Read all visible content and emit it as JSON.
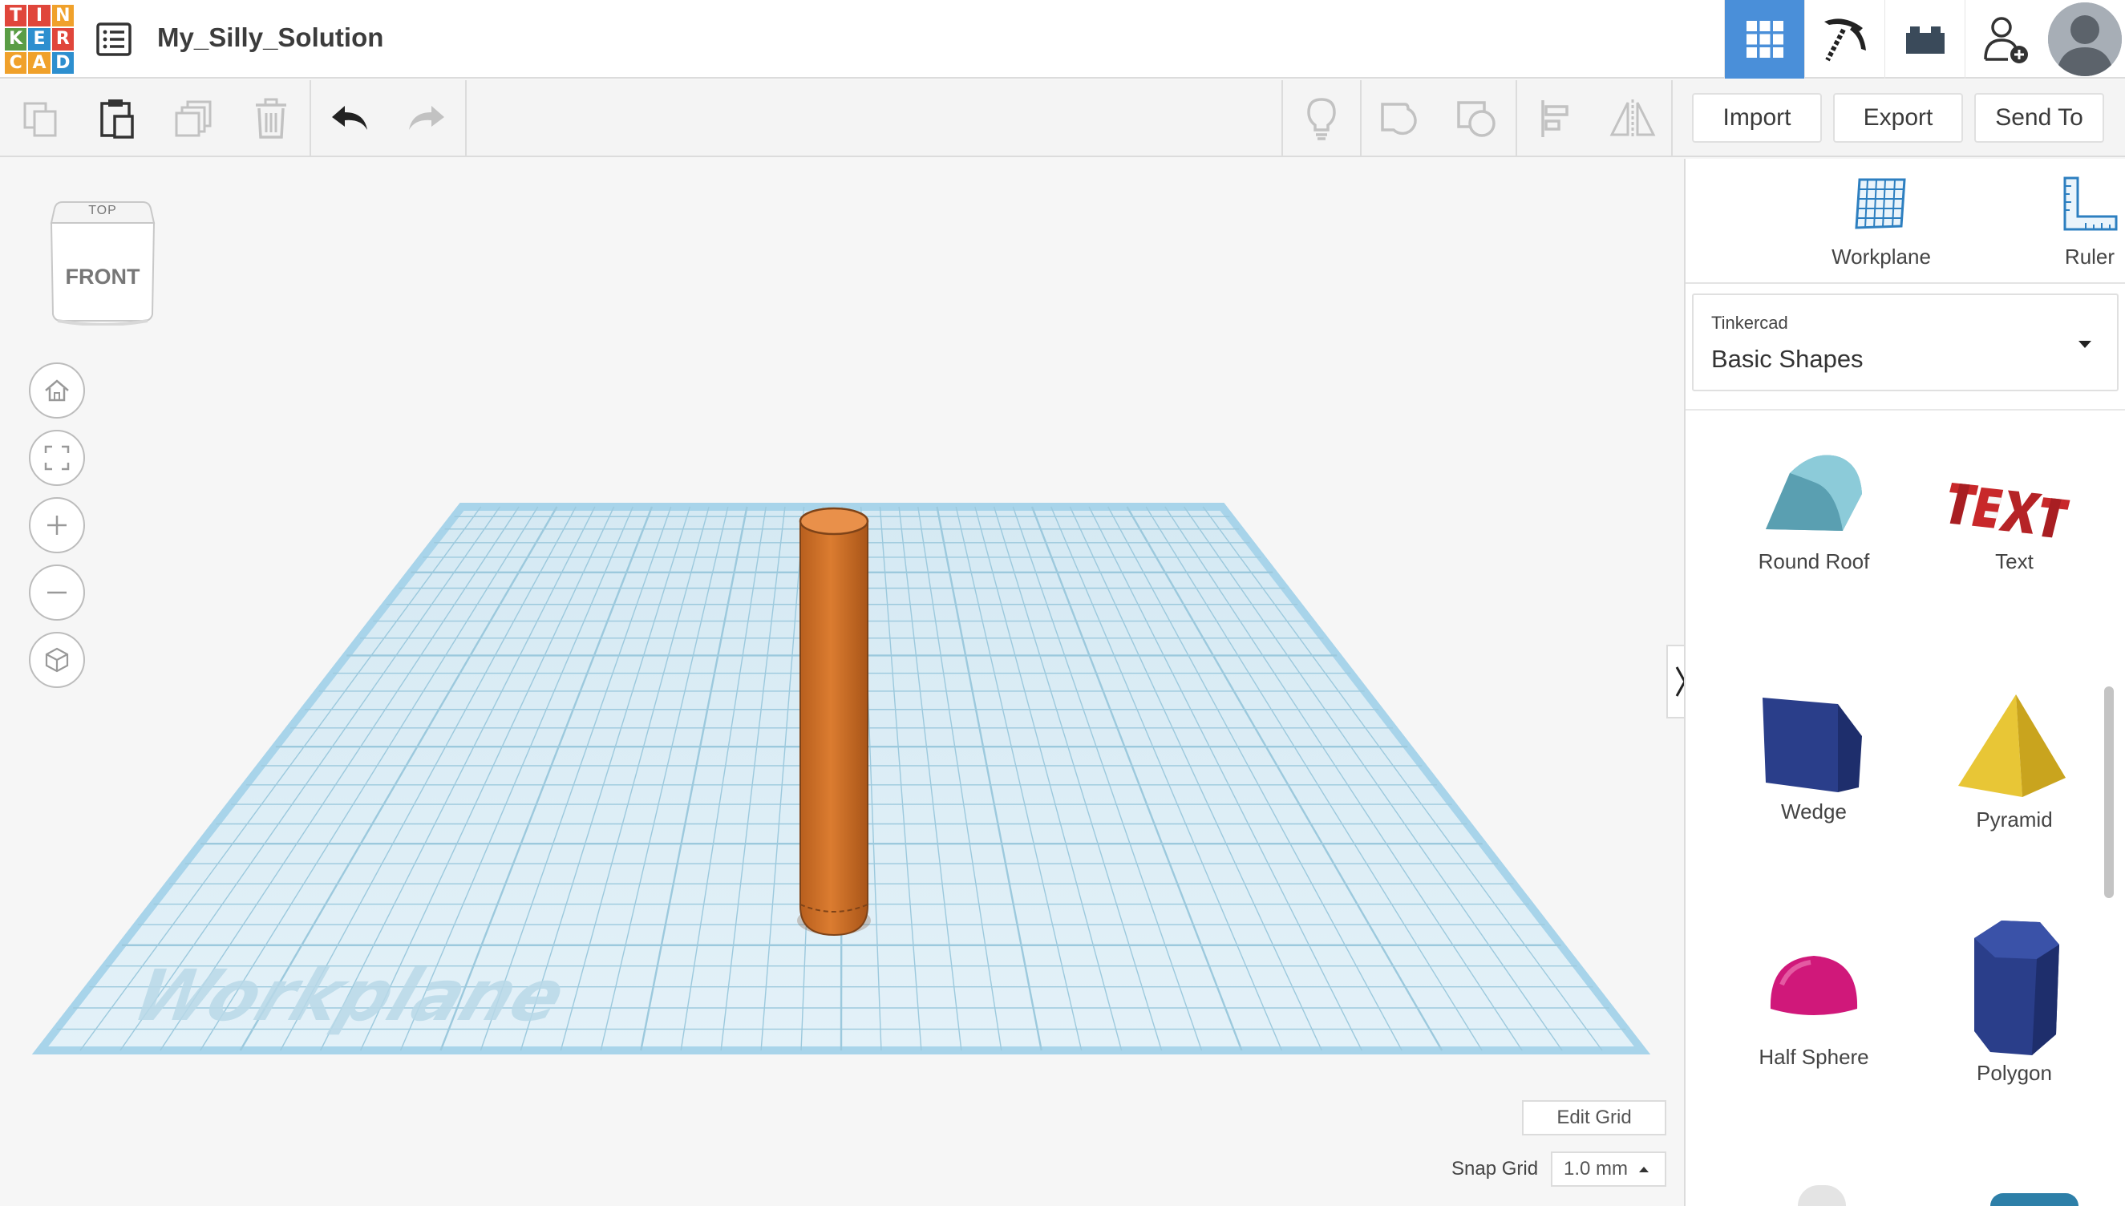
{
  "app": {
    "logo_letters": [
      "T",
      "I",
      "N",
      "K",
      "E",
      "R",
      "C",
      "A",
      "D"
    ],
    "logo_colors": [
      "#e0463b",
      "#e0463b",
      "#f0a12b",
      "#5a9d45",
      "#2d8fcf",
      "#e0463b",
      "#f0a12b",
      "#f0a12b",
      "#2d8fcf"
    ],
    "document_title": "My_Silly_Solution"
  },
  "toolbar": {
    "import_label": "Import",
    "export_label": "Export",
    "send_to_label": "Send To"
  },
  "viewport": {
    "viewcube_top": "TOP",
    "viewcube_front": "FRONT",
    "workplane_watermark": "Workplane",
    "edit_grid_label": "Edit Grid",
    "snap_grid_label": "Snap Grid",
    "snap_grid_value": "1.0 mm",
    "colors": {
      "grid_fill": "#dcedf5",
      "grid_line": "#9cc9dd",
      "grid_border": "#a8d4ea",
      "cylinder": "#d9782e",
      "cylinder_top": "#e9904a"
    }
  },
  "side_panel": {
    "workplane_label": "Workplane",
    "ruler_label": "Ruler",
    "library_vendor": "Tinkercad",
    "library_name": "Basic Shapes",
    "shapes": [
      {
        "label": "Round Roof",
        "color": "#7bbfcf"
      },
      {
        "label": "Text",
        "color": "#c8282a"
      },
      {
        "label": "Wedge",
        "color": "#2a3e8a"
      },
      {
        "label": "Pyramid",
        "color": "#e8c636"
      },
      {
        "label": "Half Sphere",
        "color": "#d0187a"
      },
      {
        "label": "Polygon",
        "color": "#2a3e8a"
      }
    ]
  }
}
